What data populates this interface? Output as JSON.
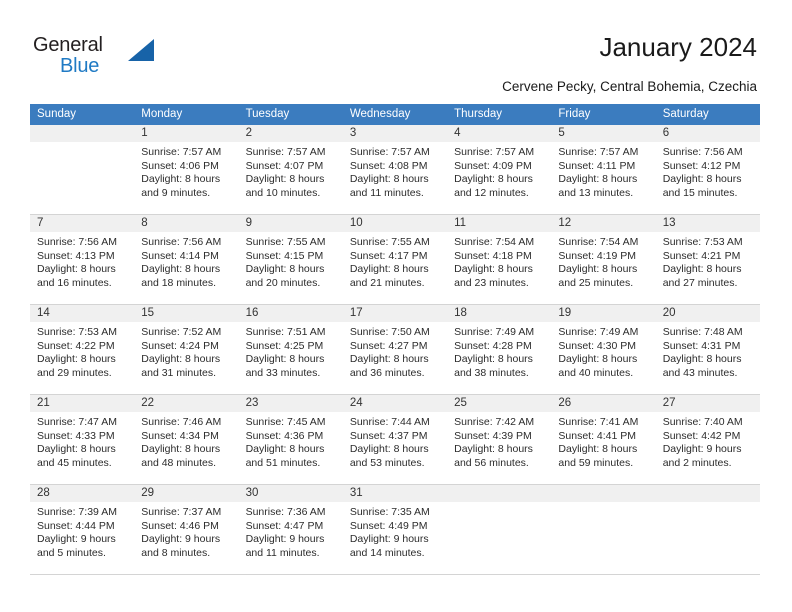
{
  "brand": {
    "name_part1": "General",
    "name_part2": "Blue",
    "triangle_color": "#1763a8",
    "blue_color": "#1f7ac4"
  },
  "header": {
    "title": "January 2024",
    "subtitle": "Cervene Pecky, Central Bohemia, Czechia"
  },
  "theme": {
    "header_bg": "#3b7cbf",
    "daynum_bg": "#f0f0f0",
    "cell_bg": "#ffffff",
    "grid_line": "#d4d4d4",
    "text": "#2c2c2c"
  },
  "weekdays": [
    "Sunday",
    "Monday",
    "Tuesday",
    "Wednesday",
    "Thursday",
    "Friday",
    "Saturday"
  ],
  "weeks": [
    [
      {
        "day": "",
        "empty": true,
        "l1": "",
        "l2": "",
        "l3": "",
        "l4": ""
      },
      {
        "day": "1",
        "l1": "Sunrise: 7:57 AM",
        "l2": "Sunset: 4:06 PM",
        "l3": "Daylight: 8 hours",
        "l4": "and 9 minutes."
      },
      {
        "day": "2",
        "l1": "Sunrise: 7:57 AM",
        "l2": "Sunset: 4:07 PM",
        "l3": "Daylight: 8 hours",
        "l4": "and 10 minutes."
      },
      {
        "day": "3",
        "l1": "Sunrise: 7:57 AM",
        "l2": "Sunset: 4:08 PM",
        "l3": "Daylight: 8 hours",
        "l4": "and 11 minutes."
      },
      {
        "day": "4",
        "l1": "Sunrise: 7:57 AM",
        "l2": "Sunset: 4:09 PM",
        "l3": "Daylight: 8 hours",
        "l4": "and 12 minutes."
      },
      {
        "day": "5",
        "l1": "Sunrise: 7:57 AM",
        "l2": "Sunset: 4:11 PM",
        "l3": "Daylight: 8 hours",
        "l4": "and 13 minutes."
      },
      {
        "day": "6",
        "l1": "Sunrise: 7:56 AM",
        "l2": "Sunset: 4:12 PM",
        "l3": "Daylight: 8 hours",
        "l4": "and 15 minutes."
      }
    ],
    [
      {
        "day": "7",
        "l1": "Sunrise: 7:56 AM",
        "l2": "Sunset: 4:13 PM",
        "l3": "Daylight: 8 hours",
        "l4": "and 16 minutes."
      },
      {
        "day": "8",
        "l1": "Sunrise: 7:56 AM",
        "l2": "Sunset: 4:14 PM",
        "l3": "Daylight: 8 hours",
        "l4": "and 18 minutes."
      },
      {
        "day": "9",
        "l1": "Sunrise: 7:55 AM",
        "l2": "Sunset: 4:15 PM",
        "l3": "Daylight: 8 hours",
        "l4": "and 20 minutes."
      },
      {
        "day": "10",
        "l1": "Sunrise: 7:55 AM",
        "l2": "Sunset: 4:17 PM",
        "l3": "Daylight: 8 hours",
        "l4": "and 21 minutes."
      },
      {
        "day": "11",
        "l1": "Sunrise: 7:54 AM",
        "l2": "Sunset: 4:18 PM",
        "l3": "Daylight: 8 hours",
        "l4": "and 23 minutes."
      },
      {
        "day": "12",
        "l1": "Sunrise: 7:54 AM",
        "l2": "Sunset: 4:19 PM",
        "l3": "Daylight: 8 hours",
        "l4": "and 25 minutes."
      },
      {
        "day": "13",
        "l1": "Sunrise: 7:53 AM",
        "l2": "Sunset: 4:21 PM",
        "l3": "Daylight: 8 hours",
        "l4": "and 27 minutes."
      }
    ],
    [
      {
        "day": "14",
        "l1": "Sunrise: 7:53 AM",
        "l2": "Sunset: 4:22 PM",
        "l3": "Daylight: 8 hours",
        "l4": "and 29 minutes."
      },
      {
        "day": "15",
        "l1": "Sunrise: 7:52 AM",
        "l2": "Sunset: 4:24 PM",
        "l3": "Daylight: 8 hours",
        "l4": "and 31 minutes."
      },
      {
        "day": "16",
        "l1": "Sunrise: 7:51 AM",
        "l2": "Sunset: 4:25 PM",
        "l3": "Daylight: 8 hours",
        "l4": "and 33 minutes."
      },
      {
        "day": "17",
        "l1": "Sunrise: 7:50 AM",
        "l2": "Sunset: 4:27 PM",
        "l3": "Daylight: 8 hours",
        "l4": "and 36 minutes."
      },
      {
        "day": "18",
        "l1": "Sunrise: 7:49 AM",
        "l2": "Sunset: 4:28 PM",
        "l3": "Daylight: 8 hours",
        "l4": "and 38 minutes."
      },
      {
        "day": "19",
        "l1": "Sunrise: 7:49 AM",
        "l2": "Sunset: 4:30 PM",
        "l3": "Daylight: 8 hours",
        "l4": "and 40 minutes."
      },
      {
        "day": "20",
        "l1": "Sunrise: 7:48 AM",
        "l2": "Sunset: 4:31 PM",
        "l3": "Daylight: 8 hours",
        "l4": "and 43 minutes."
      }
    ],
    [
      {
        "day": "21",
        "l1": "Sunrise: 7:47 AM",
        "l2": "Sunset: 4:33 PM",
        "l3": "Daylight: 8 hours",
        "l4": "and 45 minutes."
      },
      {
        "day": "22",
        "l1": "Sunrise: 7:46 AM",
        "l2": "Sunset: 4:34 PM",
        "l3": "Daylight: 8 hours",
        "l4": "and 48 minutes."
      },
      {
        "day": "23",
        "l1": "Sunrise: 7:45 AM",
        "l2": "Sunset: 4:36 PM",
        "l3": "Daylight: 8 hours",
        "l4": "and 51 minutes."
      },
      {
        "day": "24",
        "l1": "Sunrise: 7:44 AM",
        "l2": "Sunset: 4:37 PM",
        "l3": "Daylight: 8 hours",
        "l4": "and 53 minutes."
      },
      {
        "day": "25",
        "l1": "Sunrise: 7:42 AM",
        "l2": "Sunset: 4:39 PM",
        "l3": "Daylight: 8 hours",
        "l4": "and 56 minutes."
      },
      {
        "day": "26",
        "l1": "Sunrise: 7:41 AM",
        "l2": "Sunset: 4:41 PM",
        "l3": "Daylight: 8 hours",
        "l4": "and 59 minutes."
      },
      {
        "day": "27",
        "l1": "Sunrise: 7:40 AM",
        "l2": "Sunset: 4:42 PM",
        "l3": "Daylight: 9 hours",
        "l4": "and 2 minutes."
      }
    ],
    [
      {
        "day": "28",
        "l1": "Sunrise: 7:39 AM",
        "l2": "Sunset: 4:44 PM",
        "l3": "Daylight: 9 hours",
        "l4": "and 5 minutes."
      },
      {
        "day": "29",
        "l1": "Sunrise: 7:37 AM",
        "l2": "Sunset: 4:46 PM",
        "l3": "Daylight: 9 hours",
        "l4": "and 8 minutes."
      },
      {
        "day": "30",
        "l1": "Sunrise: 7:36 AM",
        "l2": "Sunset: 4:47 PM",
        "l3": "Daylight: 9 hours",
        "l4": "and 11 minutes."
      },
      {
        "day": "31",
        "l1": "Sunrise: 7:35 AM",
        "l2": "Sunset: 4:49 PM",
        "l3": "Daylight: 9 hours",
        "l4": "and 14 minutes."
      },
      {
        "day": "",
        "empty": true,
        "l1": "",
        "l2": "",
        "l3": "",
        "l4": ""
      },
      {
        "day": "",
        "empty": true,
        "l1": "",
        "l2": "",
        "l3": "",
        "l4": ""
      },
      {
        "day": "",
        "empty": true,
        "l1": "",
        "l2": "",
        "l3": "",
        "l4": ""
      }
    ]
  ]
}
